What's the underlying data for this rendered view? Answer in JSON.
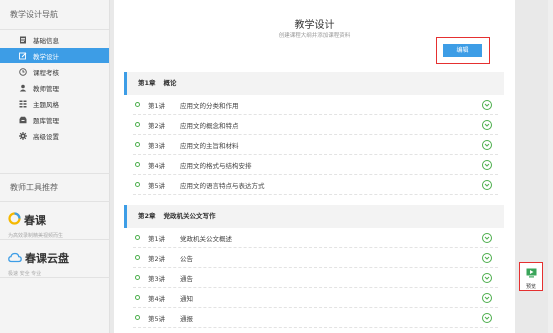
{
  "sidebar": {
    "nav_title": "教学设计导航",
    "items": [
      {
        "label": "基础信息",
        "icon": "document-icon",
        "active": false
      },
      {
        "label": "教学设计",
        "icon": "edit-icon",
        "active": true
      },
      {
        "label": "课程考核",
        "icon": "clock-icon",
        "active": false
      },
      {
        "label": "教师管理",
        "icon": "user-icon",
        "active": false
      },
      {
        "label": "主题风格",
        "icon": "grid-icon",
        "active": false
      },
      {
        "label": "题库管理",
        "icon": "archive-icon",
        "active": false
      },
      {
        "label": "高级设置",
        "icon": "gear-icon",
        "active": false
      }
    ],
    "tools_title": "教师工具推荐",
    "tools": [
      {
        "name": "春课",
        "subtitle": "为高效录制精美视频而生",
        "icon": "chunke-logo-icon"
      },
      {
        "name": "春课云盘",
        "subtitle": "极速 安全 专业",
        "icon": "cloud-icon"
      }
    ]
  },
  "main": {
    "title": "教学设计",
    "subtitle": "创建课程大纲并添加课程资料",
    "edit_label": "编辑",
    "chapters": [
      {
        "num": "第1章",
        "title": "概论",
        "lessons": [
          {
            "num": "第1讲",
            "title": "应用文的分类和作用"
          },
          {
            "num": "第2讲",
            "title": "应用文的概念和特点"
          },
          {
            "num": "第3讲",
            "title": "应用文的主旨和材料"
          },
          {
            "num": "第4讲",
            "title": "应用文的格式与结构安排"
          },
          {
            "num": "第5讲",
            "title": "应用文的语言特点与表达方式"
          }
        ]
      },
      {
        "num": "第2章",
        "title": "党政机关公文写作",
        "lessons": [
          {
            "num": "第1讲",
            "title": "党政机关公文概述"
          },
          {
            "num": "第2讲",
            "title": "公告"
          },
          {
            "num": "第3讲",
            "title": "通告"
          },
          {
            "num": "第4讲",
            "title": "通知"
          },
          {
            "num": "第5讲",
            "title": "通报"
          }
        ]
      }
    ]
  },
  "preview": {
    "label": "预览",
    "icon": "preview-icon"
  },
  "colors": {
    "accent": "#3d9de6",
    "highlight": "#e53030",
    "lesson_icon": "#4cae4c"
  }
}
